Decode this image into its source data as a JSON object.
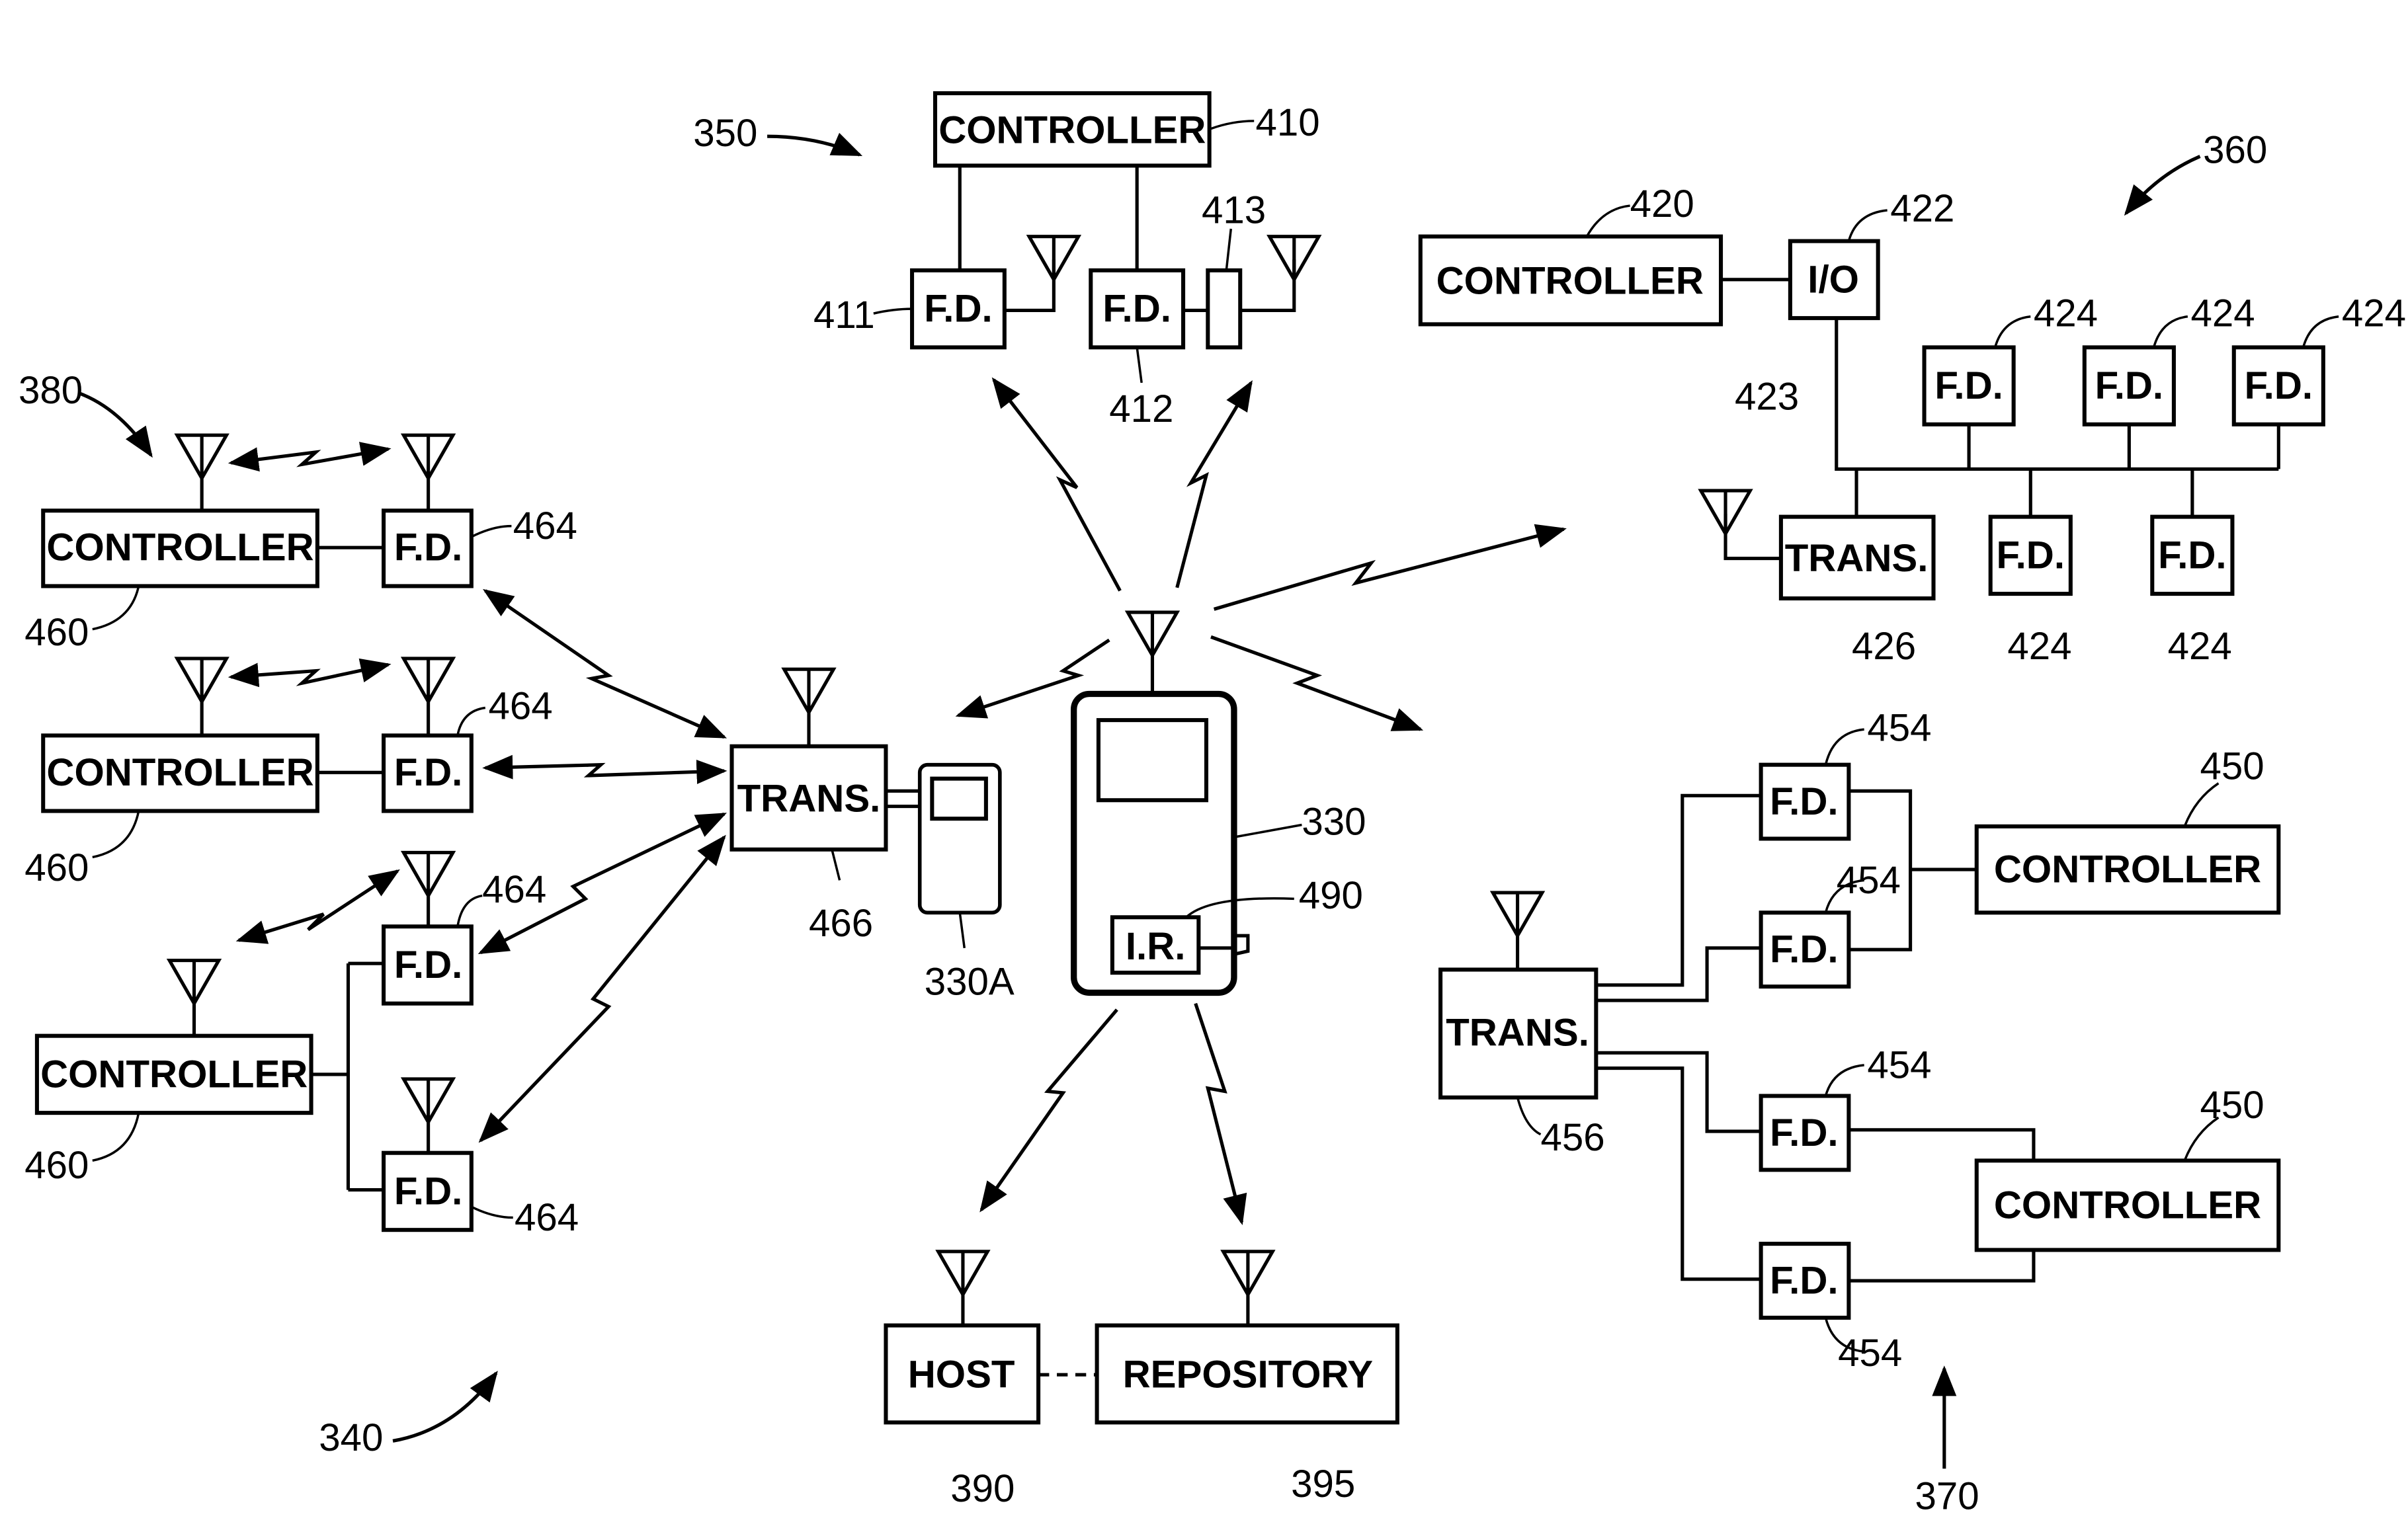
{
  "figure": {
    "central_device": {
      "ref": "330",
      "ir_label": "I.R.",
      "ir_ref": "490"
    },
    "secondary_device": {
      "ref": "330A"
    },
    "group_350": {
      "ref": "350",
      "controller": {
        "label": "CONTROLLER",
        "ref": "410"
      },
      "fd_1": {
        "label": "F.D.",
        "ref": "411"
      },
      "fd_2": {
        "label": "F.D.",
        "ref": "412"
      },
      "adapter_ref": "413"
    },
    "group_360": {
      "ref": "360",
      "controller": {
        "label": "CONTROLLER",
        "ref": "420"
      },
      "io": {
        "label": "I/O",
        "ref": "422"
      },
      "bus_ref": "423",
      "trans": {
        "label": "TRANS.",
        "ref": "426"
      },
      "fd_label": "F.D.",
      "fd_ref": "424"
    },
    "group_370": {
      "ref": "370",
      "trans": {
        "label": "TRANS.",
        "ref": "456"
      },
      "controller_label": "CONTROLLER",
      "controller_ref": "450",
      "fd_label": "F.D.",
      "fd_ref": "454"
    },
    "group_340": {
      "ref": "340",
      "trans": {
        "label": "TRANS.",
        "ref": "466"
      },
      "controller_label": "CONTROLLER",
      "controller_ref": "460",
      "fd_label": "F.D.",
      "fd_ref": "464",
      "subgroup_ref": "380"
    },
    "host": {
      "label": "HOST",
      "ref": "390"
    },
    "repository": {
      "label": "REPOSITORY",
      "ref": "395"
    }
  }
}
